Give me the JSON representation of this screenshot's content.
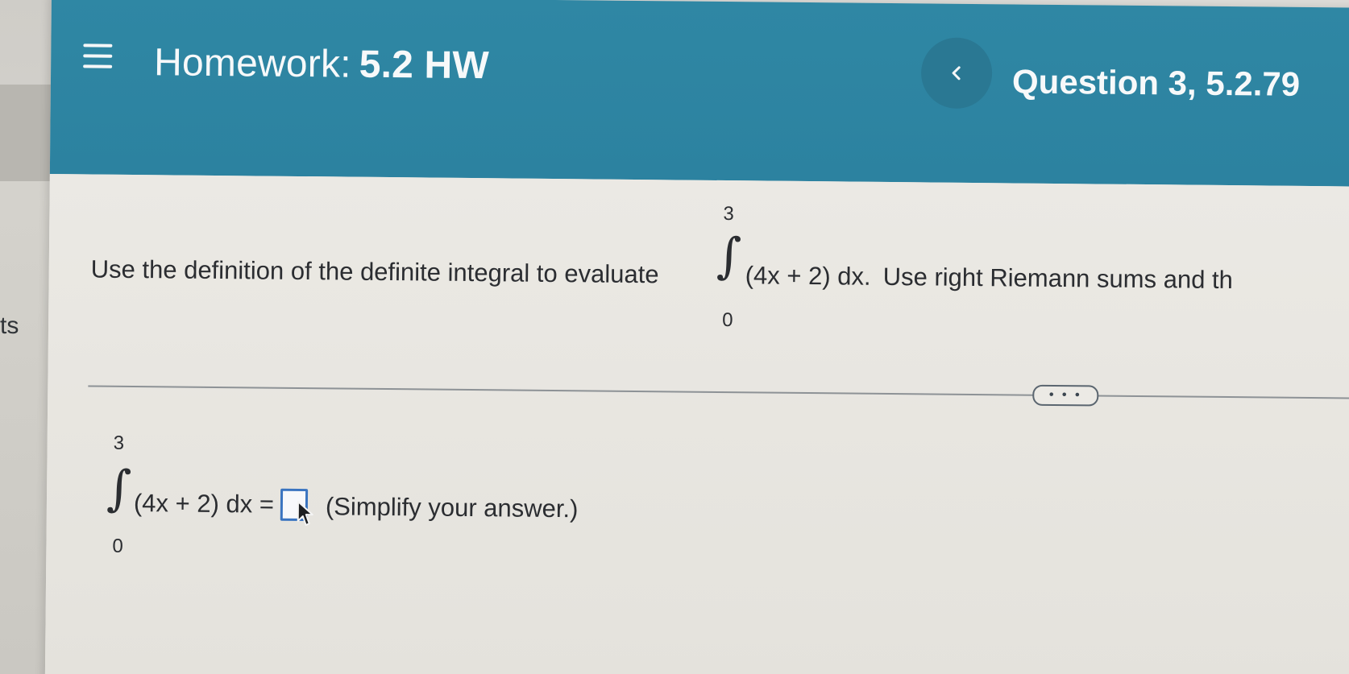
{
  "left_panel": {
    "partial_label": "ts"
  },
  "header": {
    "menu_icon": "hamburger-menu-icon",
    "title_prefix": "Homework:",
    "title_name": "5.2 HW",
    "prev_icon": "chevron-left-icon",
    "question_label": "Question 3, 5.2.79",
    "background_color": "#2f87a4"
  },
  "question": {
    "lead": "Use the definition of the definite integral to evaluate",
    "integral": {
      "upper": "3",
      "lower": "0",
      "integrand": "(4x + 2) dx."
    },
    "tail": "Use right Riemann sums and th"
  },
  "more_button": {
    "label": "• • •"
  },
  "answer": {
    "integral": {
      "upper": "3",
      "lower": "0",
      "integrand": "(4x + 2) dx ="
    },
    "input_value": "",
    "hint": "(Simplify your answer.)"
  }
}
